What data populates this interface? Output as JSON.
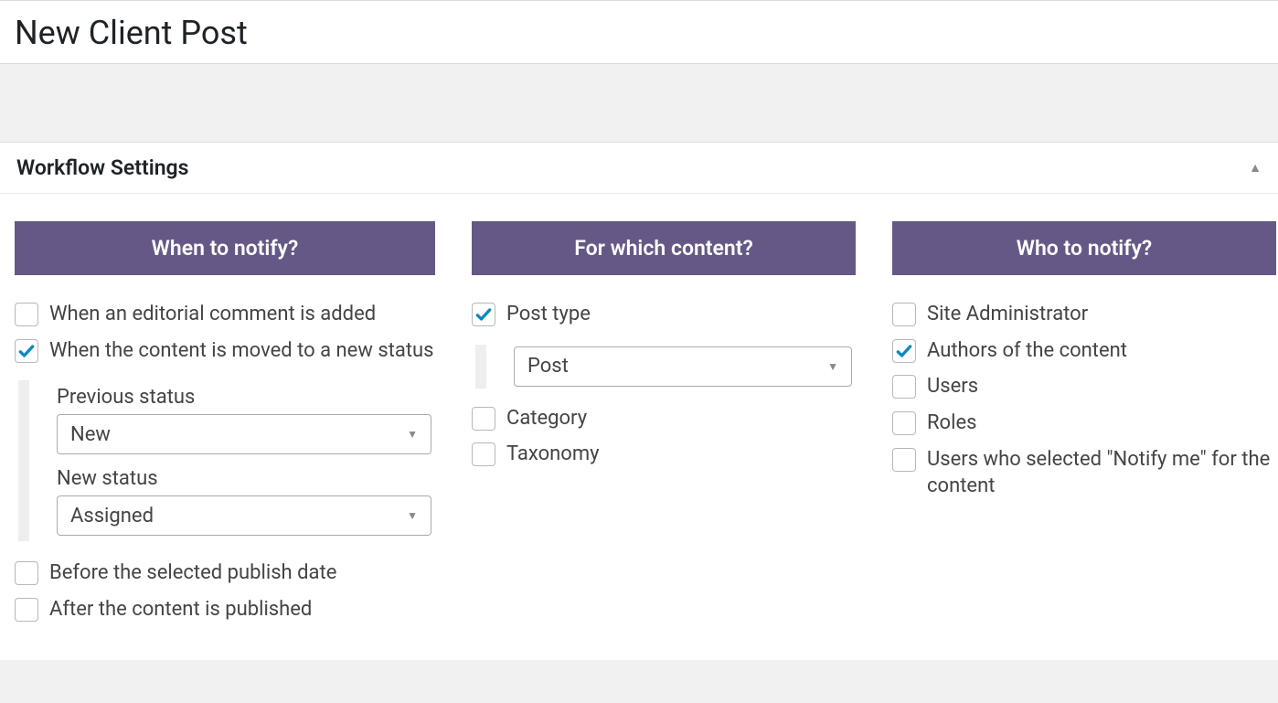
{
  "page": {
    "title": "New Client Post"
  },
  "panel": {
    "title": "Workflow Settings"
  },
  "columns": {
    "when": {
      "heading": "When to notify?",
      "opt_editorial_comment": {
        "label": "When an editorial comment is added",
        "checked": false
      },
      "opt_moved_status": {
        "label": "When the content is moved to a new status",
        "checked": true
      },
      "previous_status": {
        "label": "Previous status",
        "value": "New"
      },
      "new_status": {
        "label": "New status",
        "value": "Assigned"
      },
      "opt_before_publish": {
        "label": "Before the selected publish date",
        "checked": false
      },
      "opt_after_published": {
        "label": "After the content is published",
        "checked": false
      }
    },
    "content": {
      "heading": "For which content?",
      "opt_post_type": {
        "label": "Post type",
        "checked": true
      },
      "post_type_select": {
        "value": "Post"
      },
      "opt_category": {
        "label": "Category",
        "checked": false
      },
      "opt_taxonomy": {
        "label": "Taxonomy",
        "checked": false
      }
    },
    "who": {
      "heading": "Who to notify?",
      "opt_site_admin": {
        "label": "Site Administrator",
        "checked": false
      },
      "opt_authors": {
        "label": "Authors of the content",
        "checked": true
      },
      "opt_users": {
        "label": "Users",
        "checked": false
      },
      "opt_roles": {
        "label": "Roles",
        "checked": false
      },
      "opt_notify_me": {
        "label": "Users who selected \"Notify me\" for the content",
        "checked": false
      }
    }
  },
  "colors": {
    "accent": "#655886",
    "check": "#0d88bf"
  }
}
